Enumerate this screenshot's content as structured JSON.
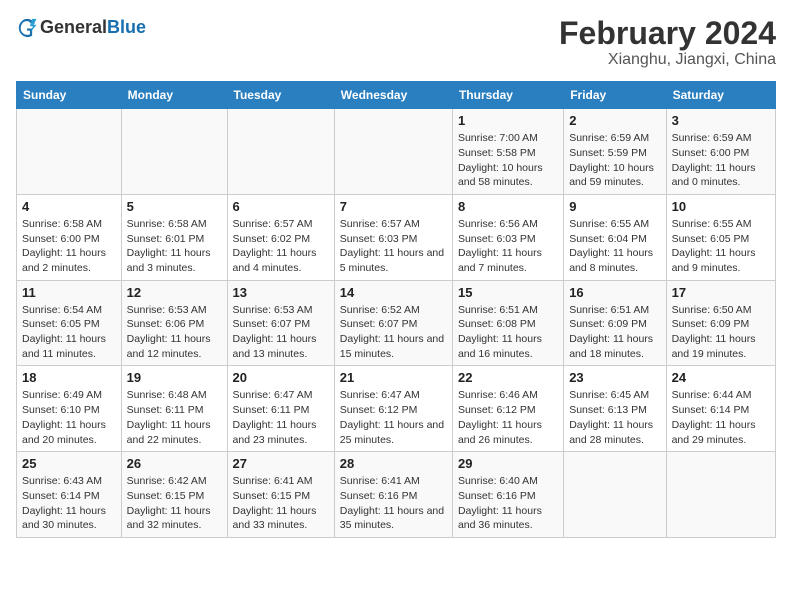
{
  "header": {
    "logo_general": "General",
    "logo_blue": "Blue",
    "title": "February 2024",
    "subtitle": "Xianghu, Jiangxi, China"
  },
  "weekdays": [
    "Sunday",
    "Monday",
    "Tuesday",
    "Wednesday",
    "Thursday",
    "Friday",
    "Saturday"
  ],
  "weeks": [
    [
      {
        "day": "",
        "sunrise": "",
        "sunset": "",
        "daylight": ""
      },
      {
        "day": "",
        "sunrise": "",
        "sunset": "",
        "daylight": ""
      },
      {
        "day": "",
        "sunrise": "",
        "sunset": "",
        "daylight": ""
      },
      {
        "day": "",
        "sunrise": "",
        "sunset": "",
        "daylight": ""
      },
      {
        "day": "1",
        "sunrise": "Sunrise: 7:00 AM",
        "sunset": "Sunset: 5:58 PM",
        "daylight": "Daylight: 10 hours and 58 minutes."
      },
      {
        "day": "2",
        "sunrise": "Sunrise: 6:59 AM",
        "sunset": "Sunset: 5:59 PM",
        "daylight": "Daylight: 10 hours and 59 minutes."
      },
      {
        "day": "3",
        "sunrise": "Sunrise: 6:59 AM",
        "sunset": "Sunset: 6:00 PM",
        "daylight": "Daylight: 11 hours and 0 minutes."
      }
    ],
    [
      {
        "day": "4",
        "sunrise": "Sunrise: 6:58 AM",
        "sunset": "Sunset: 6:00 PM",
        "daylight": "Daylight: 11 hours and 2 minutes."
      },
      {
        "day": "5",
        "sunrise": "Sunrise: 6:58 AM",
        "sunset": "Sunset: 6:01 PM",
        "daylight": "Daylight: 11 hours and 3 minutes."
      },
      {
        "day": "6",
        "sunrise": "Sunrise: 6:57 AM",
        "sunset": "Sunset: 6:02 PM",
        "daylight": "Daylight: 11 hours and 4 minutes."
      },
      {
        "day": "7",
        "sunrise": "Sunrise: 6:57 AM",
        "sunset": "Sunset: 6:03 PM",
        "daylight": "Daylight: 11 hours and 5 minutes."
      },
      {
        "day": "8",
        "sunrise": "Sunrise: 6:56 AM",
        "sunset": "Sunset: 6:03 PM",
        "daylight": "Daylight: 11 hours and 7 minutes."
      },
      {
        "day": "9",
        "sunrise": "Sunrise: 6:55 AM",
        "sunset": "Sunset: 6:04 PM",
        "daylight": "Daylight: 11 hours and 8 minutes."
      },
      {
        "day": "10",
        "sunrise": "Sunrise: 6:55 AM",
        "sunset": "Sunset: 6:05 PM",
        "daylight": "Daylight: 11 hours and 9 minutes."
      }
    ],
    [
      {
        "day": "11",
        "sunrise": "Sunrise: 6:54 AM",
        "sunset": "Sunset: 6:05 PM",
        "daylight": "Daylight: 11 hours and 11 minutes."
      },
      {
        "day": "12",
        "sunrise": "Sunrise: 6:53 AM",
        "sunset": "Sunset: 6:06 PM",
        "daylight": "Daylight: 11 hours and 12 minutes."
      },
      {
        "day": "13",
        "sunrise": "Sunrise: 6:53 AM",
        "sunset": "Sunset: 6:07 PM",
        "daylight": "Daylight: 11 hours and 13 minutes."
      },
      {
        "day": "14",
        "sunrise": "Sunrise: 6:52 AM",
        "sunset": "Sunset: 6:07 PM",
        "daylight": "Daylight: 11 hours and 15 minutes."
      },
      {
        "day": "15",
        "sunrise": "Sunrise: 6:51 AM",
        "sunset": "Sunset: 6:08 PM",
        "daylight": "Daylight: 11 hours and 16 minutes."
      },
      {
        "day": "16",
        "sunrise": "Sunrise: 6:51 AM",
        "sunset": "Sunset: 6:09 PM",
        "daylight": "Daylight: 11 hours and 18 minutes."
      },
      {
        "day": "17",
        "sunrise": "Sunrise: 6:50 AM",
        "sunset": "Sunset: 6:09 PM",
        "daylight": "Daylight: 11 hours and 19 minutes."
      }
    ],
    [
      {
        "day": "18",
        "sunrise": "Sunrise: 6:49 AM",
        "sunset": "Sunset: 6:10 PM",
        "daylight": "Daylight: 11 hours and 20 minutes."
      },
      {
        "day": "19",
        "sunrise": "Sunrise: 6:48 AM",
        "sunset": "Sunset: 6:11 PM",
        "daylight": "Daylight: 11 hours and 22 minutes."
      },
      {
        "day": "20",
        "sunrise": "Sunrise: 6:47 AM",
        "sunset": "Sunset: 6:11 PM",
        "daylight": "Daylight: 11 hours and 23 minutes."
      },
      {
        "day": "21",
        "sunrise": "Sunrise: 6:47 AM",
        "sunset": "Sunset: 6:12 PM",
        "daylight": "Daylight: 11 hours and 25 minutes."
      },
      {
        "day": "22",
        "sunrise": "Sunrise: 6:46 AM",
        "sunset": "Sunset: 6:12 PM",
        "daylight": "Daylight: 11 hours and 26 minutes."
      },
      {
        "day": "23",
        "sunrise": "Sunrise: 6:45 AM",
        "sunset": "Sunset: 6:13 PM",
        "daylight": "Daylight: 11 hours and 28 minutes."
      },
      {
        "day": "24",
        "sunrise": "Sunrise: 6:44 AM",
        "sunset": "Sunset: 6:14 PM",
        "daylight": "Daylight: 11 hours and 29 minutes."
      }
    ],
    [
      {
        "day": "25",
        "sunrise": "Sunrise: 6:43 AM",
        "sunset": "Sunset: 6:14 PM",
        "daylight": "Daylight: 11 hours and 30 minutes."
      },
      {
        "day": "26",
        "sunrise": "Sunrise: 6:42 AM",
        "sunset": "Sunset: 6:15 PM",
        "daylight": "Daylight: 11 hours and 32 minutes."
      },
      {
        "day": "27",
        "sunrise": "Sunrise: 6:41 AM",
        "sunset": "Sunset: 6:15 PM",
        "daylight": "Daylight: 11 hours and 33 minutes."
      },
      {
        "day": "28",
        "sunrise": "Sunrise: 6:41 AM",
        "sunset": "Sunset: 6:16 PM",
        "daylight": "Daylight: 11 hours and 35 minutes."
      },
      {
        "day": "29",
        "sunrise": "Sunrise: 6:40 AM",
        "sunset": "Sunset: 6:16 PM",
        "daylight": "Daylight: 11 hours and 36 minutes."
      },
      {
        "day": "",
        "sunrise": "",
        "sunset": "",
        "daylight": ""
      },
      {
        "day": "",
        "sunrise": "",
        "sunset": "",
        "daylight": ""
      }
    ]
  ]
}
